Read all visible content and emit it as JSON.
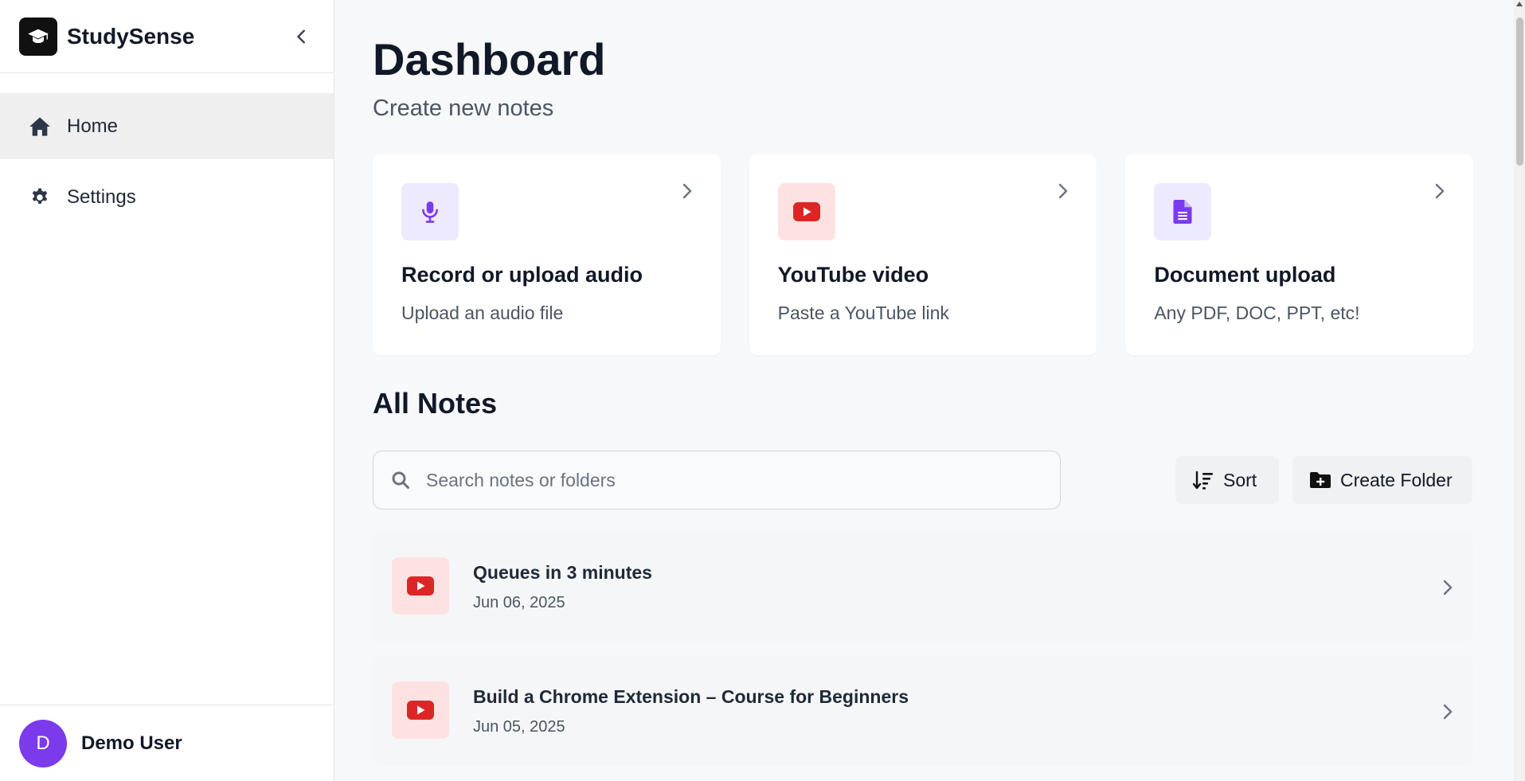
{
  "app": {
    "name": "StudySense"
  },
  "sidebar": {
    "items": [
      {
        "label": "Home",
        "icon": "home-icon",
        "active": true
      },
      {
        "label": "Settings",
        "icon": "gear-icon",
        "active": false
      }
    ],
    "user": {
      "initial": "D",
      "name": "Demo User",
      "avatar_color": "#7c3aed"
    }
  },
  "main": {
    "title": "Dashboard",
    "subtitle": "Create new notes",
    "cards": [
      {
        "title": "Record or upload audio",
        "description": "Upload an audio file",
        "icon": "microphone-icon",
        "accent": "#7c3aed"
      },
      {
        "title": "YouTube video",
        "description": "Paste a YouTube link",
        "icon": "youtube-icon",
        "accent": "#dc2626"
      },
      {
        "title": "Document upload",
        "description": "Any PDF, DOC, PPT, etc!",
        "icon": "document-icon",
        "accent": "#7c3aed"
      }
    ],
    "notes_section": {
      "title": "All Notes",
      "search_placeholder": "Search notes or folders",
      "sort_label": "Sort",
      "create_folder_label": "Create Folder",
      "notes": [
        {
          "title": "Queues in 3 minutes",
          "date": "Jun 06, 2025",
          "icon": "youtube-icon"
        },
        {
          "title": "Build a Chrome Extension – Course for Beginners",
          "date": "Jun 05, 2025",
          "icon": "youtube-icon"
        }
      ]
    }
  }
}
